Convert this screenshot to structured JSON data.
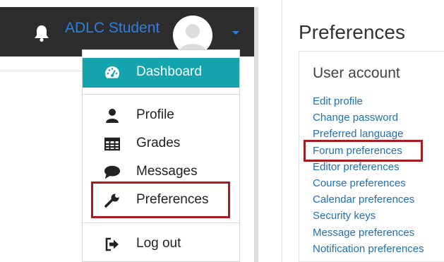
{
  "navbar": {
    "user_name": "ADLC Student",
    "icons": {
      "bell": "bell-icon",
      "avatar": "user-avatar",
      "caret": "caret-down-icon"
    }
  },
  "user_menu": {
    "dashboard": {
      "label": "Dashboard",
      "icon": "tachometer-icon"
    },
    "profile": {
      "label": "Profile",
      "icon": "user-icon"
    },
    "grades": {
      "label": "Grades",
      "icon": "table-icon"
    },
    "messages": {
      "label": "Messages",
      "icon": "speech-bubble-icon"
    },
    "preferences": {
      "label": "Preferences",
      "icon": "wrench-icon"
    },
    "logout": {
      "label": "Log out",
      "icon": "sign-out-icon"
    }
  },
  "preferences_page": {
    "title": "Preferences",
    "section_title": "User account",
    "links": [
      "Edit profile",
      "Change password",
      "Preferred language",
      "Forum preferences",
      "Editor preferences",
      "Course preferences",
      "Calendar preferences",
      "Security keys",
      "Message preferences",
      "Notification preferences"
    ]
  },
  "colors": {
    "navbar_bg": "#2d2d2d",
    "username": "#2f7fe0",
    "active_item_bg": "#14a4ad",
    "link": "#1f6fba",
    "highlight_border": "#a51b20"
  }
}
